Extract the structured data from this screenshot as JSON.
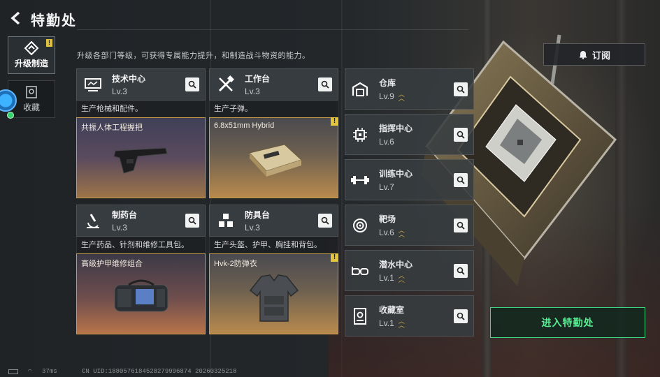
{
  "header": {
    "title": "特勤处"
  },
  "sidebar": {
    "tabs": [
      {
        "label": "升级制造",
        "active": true,
        "notice": "!"
      },
      {
        "label": "收藏",
        "active": false
      }
    ]
  },
  "intro": "升级各部门等级，可获得专属能力提升，和制造战斗物资的能力。",
  "workshops": [
    {
      "name": "技术中心",
      "level": "Lv.3",
      "desc": "生产枪械和配件。",
      "craft": "共振人体工程握把",
      "icon": "monitor-icon",
      "craft_style": "purple"
    },
    {
      "name": "工作台",
      "level": "Lv.3",
      "desc": "生产子弹。",
      "craft": "6.8x51mm Hybrid",
      "icon": "tools-icon",
      "craft_style": "gold"
    },
    {
      "name": "制药台",
      "level": "Lv.3",
      "desc": "生产药品、针剂和维修工具包。",
      "craft": "高级护甲维修组合",
      "icon": "microscope-icon",
      "craft_style": "red"
    },
    {
      "name": "防具台",
      "level": "Lv.3",
      "desc": "生产头盔、护甲、胸挂和背包。",
      "craft": "Hvk-2防弹衣",
      "icon": "cubes-icon",
      "craft_style": "gold"
    }
  ],
  "facilities": [
    {
      "name": "仓库",
      "level": "Lv.9",
      "upgradable": true,
      "icon": "warehouse-icon"
    },
    {
      "name": "指挥中心",
      "level": "Lv.6",
      "upgradable": false,
      "icon": "chip-icon"
    },
    {
      "name": "训练中心",
      "level": "Lv.7",
      "upgradable": false,
      "icon": "dumbbell-icon"
    },
    {
      "name": "靶场",
      "level": "Lv.6",
      "upgradable": true,
      "icon": "target-icon"
    },
    {
      "name": "潜水中心",
      "level": "Lv.1",
      "upgradable": true,
      "icon": "goggles-icon"
    },
    {
      "name": "收藏室",
      "level": "Lv.1",
      "upgradable": true,
      "icon": "display-case-icon"
    }
  ],
  "actions": {
    "subscribe": "订阅",
    "enter": "进入特勤处"
  },
  "status": {
    "ping": "37ms",
    "uid": "CN UID:1880576184528279996874 20260325218"
  },
  "colors": {
    "accent_green": "#3ed57e",
    "notice_yellow": "#e0c13b",
    "craft_border": "#c89b48"
  }
}
